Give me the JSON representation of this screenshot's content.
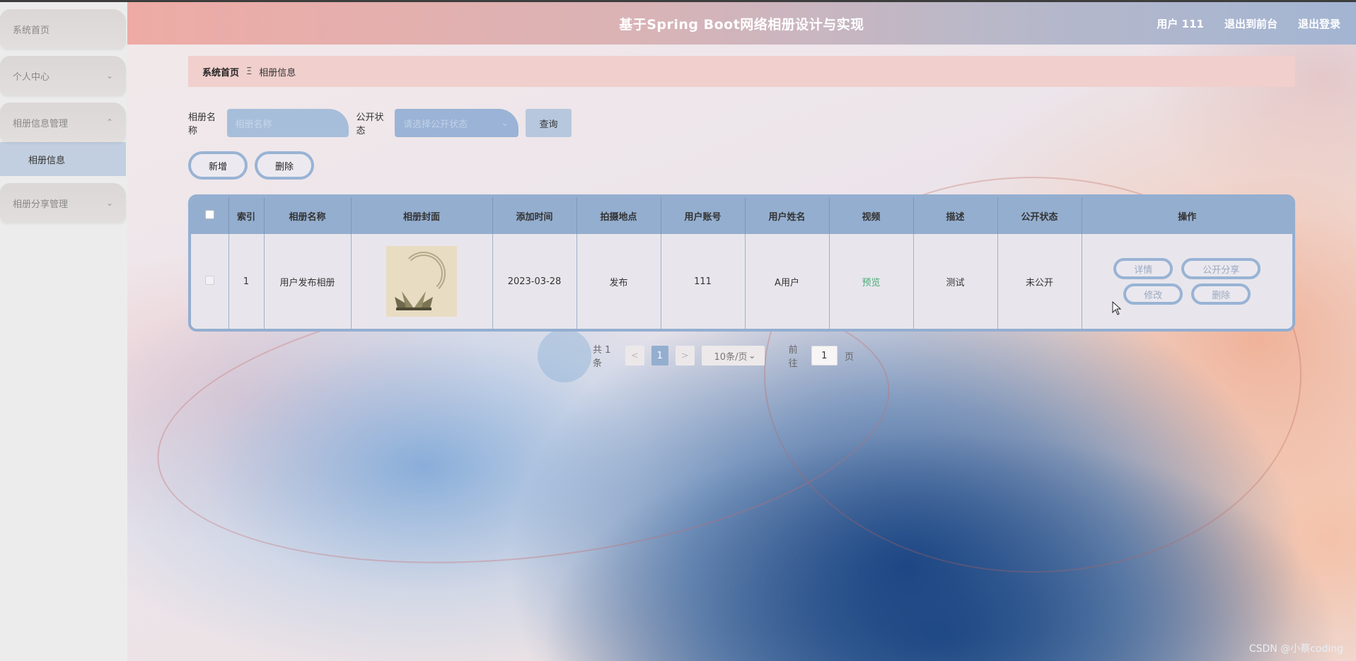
{
  "app": {
    "title": "基于Spring Boot网络相册设计与实现"
  },
  "header": {
    "user": "用户 111",
    "to_front": "退出到前台",
    "logout": "退出登录"
  },
  "sidebar": {
    "items": [
      {
        "label": "系统首页"
      },
      {
        "label": "个人中心",
        "chevron": "chevron-down-icon"
      },
      {
        "label": "相册信息管理",
        "chevron": "chevron-up-icon",
        "children": [
          {
            "label": "相册信息"
          }
        ]
      },
      {
        "label": "相册分享管理",
        "chevron": "chevron-down-icon"
      }
    ]
  },
  "breadcrumb": {
    "home": "系统首页",
    "separator": "Ξ",
    "current": "相册信息"
  },
  "search": {
    "name_label": "相册名称",
    "name_placeholder": "相册名称",
    "status_label": "公开状态",
    "status_placeholder": "请选择公开状态",
    "query_button": "查询"
  },
  "actions": {
    "add": "新增",
    "delete": "删除"
  },
  "table": {
    "headers": [
      "索引",
      "相册名称",
      "相册封面",
      "添加时间",
      "拍摄地点",
      "用户账号",
      "用户姓名",
      "视频",
      "描述",
      "公开状态",
      "操作"
    ],
    "rows": [
      {
        "index": "1",
        "name": "用户发布相册",
        "added": "2023-03-28",
        "location": "发布",
        "account": "111",
        "username": "A用户",
        "video": "预览",
        "desc": "测试",
        "status": "未公开",
        "ops": {
          "detail": "详情",
          "share": "公开分享",
          "edit": "修改",
          "delete": "删除"
        }
      }
    ]
  },
  "pagination": {
    "total": "共 1 条",
    "prev": "<",
    "page": "1",
    "next": ">",
    "page_size": "10条/页",
    "goto_label": "前往",
    "goto_value": "1",
    "goto_suffix": "页"
  },
  "watermark": "CSDN @小蔡coding",
  "colors": {
    "accent": "#94aecf",
    "breadcrumb_bg": "#f0cfcc",
    "video_link": "#4ca97a"
  }
}
